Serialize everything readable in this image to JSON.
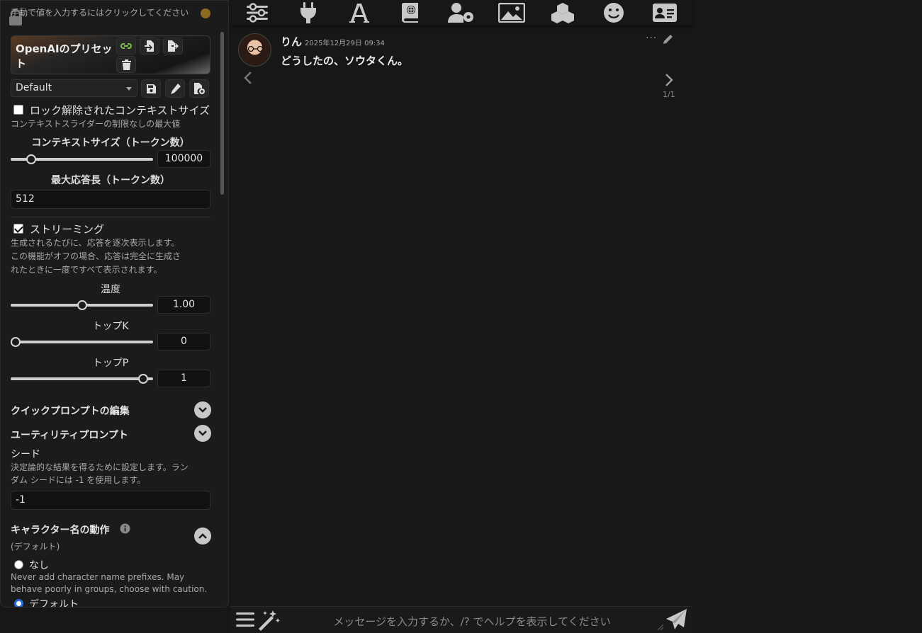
{
  "top_hint": "手動で値を入力するにはクリックしてください",
  "topbar": {
    "icons": [
      "sliders-icon",
      "plug-icon",
      "font-icon",
      "book-atlas-icon",
      "user-gear-icon",
      "image-icon",
      "cubes-icon",
      "smiley-icon",
      "id-card-icon"
    ]
  },
  "preset": {
    "title": "OpenAIのプリセット",
    "selected": "Default"
  },
  "context_unlock": {
    "label": "ロック解除されたコンテキストサイズ",
    "checked": false,
    "desc": "コンテキストスライダーの制限なしの最大値"
  },
  "context_size": {
    "label": "コンテキストサイズ（トークン数）",
    "value": "100000",
    "fraction": 0.12
  },
  "max_response": {
    "label": "最大応答長（トークン数）",
    "value": "512"
  },
  "streaming": {
    "label": "ストリーミング",
    "checked": true,
    "desc1": "生成されるたびに、応答を逐次表示します。",
    "desc2": "この機能がオフの場合、応答は完全に生成さ",
    "desc3": "れたときに一度ですべて表示されます。"
  },
  "temperature": {
    "label": "温度",
    "value": "1.00",
    "fraction": 0.5
  },
  "top_k": {
    "label": "トップK",
    "value": "0",
    "fraction": 0.0
  },
  "top_p": {
    "label": "トップP",
    "value": "1",
    "fraction": 0.96
  },
  "quick_prompts": {
    "label": "クイックプロンプトの編集"
  },
  "utility_prompts": {
    "label": "ユーティリティプロンプト"
  },
  "seed": {
    "label": "シード",
    "desc1": "決定論的な結果を得るために設定します。ラン",
    "desc2": "ダム シードには -1 を使用します。",
    "value": "-1"
  },
  "char_name_behavior": {
    "label": "キャラクター名の動作",
    "sublabel": "(デフォルト)",
    "option_none": "なし",
    "option_none_desc1": "Never add character name prefixes. May",
    "option_none_desc2": "behave poorly in groups, choose with caution.",
    "option_default": "デフォルト"
  },
  "message": {
    "name": "りん",
    "time": "2025年12月29日 09:34",
    "text": "どうしたの、ソウタくん。",
    "more": "···",
    "swipe_count": "1/1"
  },
  "chat_input": {
    "placeholder": "メッセージを入力するか、/? でヘルプを表示してください"
  },
  "colors": {
    "background": "#171717",
    "panel": "#1b1b1b",
    "link_icon": "#7fbf4a",
    "radio_checked": "#2a6ad8"
  }
}
